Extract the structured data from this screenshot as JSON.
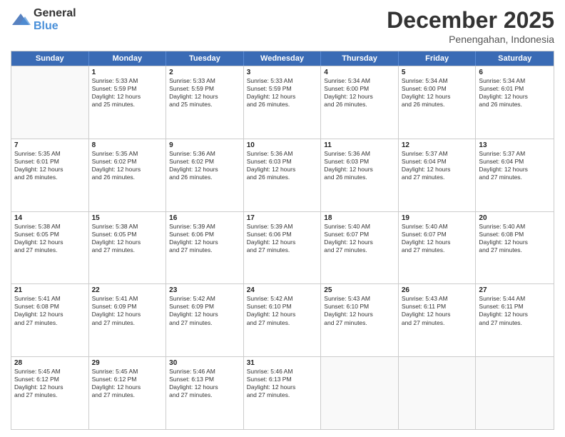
{
  "header": {
    "logo": {
      "general": "General",
      "blue": "Blue"
    },
    "month_year": "December 2025",
    "location": "Penengahan, Indonesia"
  },
  "days_of_week": [
    "Sunday",
    "Monday",
    "Tuesday",
    "Wednesday",
    "Thursday",
    "Friday",
    "Saturday"
  ],
  "rows": [
    [
      {
        "day": "",
        "sunrise": "",
        "sunset": "",
        "daylight": "",
        "empty": true
      },
      {
        "day": "1",
        "sunrise": "Sunrise: 5:33 AM",
        "sunset": "Sunset: 5:59 PM",
        "daylight": "Daylight: 12 hours",
        "daylight2": "and 25 minutes."
      },
      {
        "day": "2",
        "sunrise": "Sunrise: 5:33 AM",
        "sunset": "Sunset: 5:59 PM",
        "daylight": "Daylight: 12 hours",
        "daylight2": "and 25 minutes."
      },
      {
        "day": "3",
        "sunrise": "Sunrise: 5:33 AM",
        "sunset": "Sunset: 5:59 PM",
        "daylight": "Daylight: 12 hours",
        "daylight2": "and 26 minutes."
      },
      {
        "day": "4",
        "sunrise": "Sunrise: 5:34 AM",
        "sunset": "Sunset: 6:00 PM",
        "daylight": "Daylight: 12 hours",
        "daylight2": "and 26 minutes."
      },
      {
        "day": "5",
        "sunrise": "Sunrise: 5:34 AM",
        "sunset": "Sunset: 6:00 PM",
        "daylight": "Daylight: 12 hours",
        "daylight2": "and 26 minutes."
      },
      {
        "day": "6",
        "sunrise": "Sunrise: 5:34 AM",
        "sunset": "Sunset: 6:01 PM",
        "daylight": "Daylight: 12 hours",
        "daylight2": "and 26 minutes."
      }
    ],
    [
      {
        "day": "7",
        "sunrise": "Sunrise: 5:35 AM",
        "sunset": "Sunset: 6:01 PM",
        "daylight": "Daylight: 12 hours",
        "daylight2": "and 26 minutes."
      },
      {
        "day": "8",
        "sunrise": "Sunrise: 5:35 AM",
        "sunset": "Sunset: 6:02 PM",
        "daylight": "Daylight: 12 hours",
        "daylight2": "and 26 minutes."
      },
      {
        "day": "9",
        "sunrise": "Sunrise: 5:36 AM",
        "sunset": "Sunset: 6:02 PM",
        "daylight": "Daylight: 12 hours",
        "daylight2": "and 26 minutes."
      },
      {
        "day": "10",
        "sunrise": "Sunrise: 5:36 AM",
        "sunset": "Sunset: 6:03 PM",
        "daylight": "Daylight: 12 hours",
        "daylight2": "and 26 minutes."
      },
      {
        "day": "11",
        "sunrise": "Sunrise: 5:36 AM",
        "sunset": "Sunset: 6:03 PM",
        "daylight": "Daylight: 12 hours",
        "daylight2": "and 26 minutes."
      },
      {
        "day": "12",
        "sunrise": "Sunrise: 5:37 AM",
        "sunset": "Sunset: 6:04 PM",
        "daylight": "Daylight: 12 hours",
        "daylight2": "and 27 minutes."
      },
      {
        "day": "13",
        "sunrise": "Sunrise: 5:37 AM",
        "sunset": "Sunset: 6:04 PM",
        "daylight": "Daylight: 12 hours",
        "daylight2": "and 27 minutes."
      }
    ],
    [
      {
        "day": "14",
        "sunrise": "Sunrise: 5:38 AM",
        "sunset": "Sunset: 6:05 PM",
        "daylight": "Daylight: 12 hours",
        "daylight2": "and 27 minutes."
      },
      {
        "day": "15",
        "sunrise": "Sunrise: 5:38 AM",
        "sunset": "Sunset: 6:05 PM",
        "daylight": "Daylight: 12 hours",
        "daylight2": "and 27 minutes."
      },
      {
        "day": "16",
        "sunrise": "Sunrise: 5:39 AM",
        "sunset": "Sunset: 6:06 PM",
        "daylight": "Daylight: 12 hours",
        "daylight2": "and 27 minutes."
      },
      {
        "day": "17",
        "sunrise": "Sunrise: 5:39 AM",
        "sunset": "Sunset: 6:06 PM",
        "daylight": "Daylight: 12 hours",
        "daylight2": "and 27 minutes."
      },
      {
        "day": "18",
        "sunrise": "Sunrise: 5:40 AM",
        "sunset": "Sunset: 6:07 PM",
        "daylight": "Daylight: 12 hours",
        "daylight2": "and 27 minutes."
      },
      {
        "day": "19",
        "sunrise": "Sunrise: 5:40 AM",
        "sunset": "Sunset: 6:07 PM",
        "daylight": "Daylight: 12 hours",
        "daylight2": "and 27 minutes."
      },
      {
        "day": "20",
        "sunrise": "Sunrise: 5:40 AM",
        "sunset": "Sunset: 6:08 PM",
        "daylight": "Daylight: 12 hours",
        "daylight2": "and 27 minutes."
      }
    ],
    [
      {
        "day": "21",
        "sunrise": "Sunrise: 5:41 AM",
        "sunset": "Sunset: 6:08 PM",
        "daylight": "Daylight: 12 hours",
        "daylight2": "and 27 minutes."
      },
      {
        "day": "22",
        "sunrise": "Sunrise: 5:41 AM",
        "sunset": "Sunset: 6:09 PM",
        "daylight": "Daylight: 12 hours",
        "daylight2": "and 27 minutes."
      },
      {
        "day": "23",
        "sunrise": "Sunrise: 5:42 AM",
        "sunset": "Sunset: 6:09 PM",
        "daylight": "Daylight: 12 hours",
        "daylight2": "and 27 minutes."
      },
      {
        "day": "24",
        "sunrise": "Sunrise: 5:42 AM",
        "sunset": "Sunset: 6:10 PM",
        "daylight": "Daylight: 12 hours",
        "daylight2": "and 27 minutes."
      },
      {
        "day": "25",
        "sunrise": "Sunrise: 5:43 AM",
        "sunset": "Sunset: 6:10 PM",
        "daylight": "Daylight: 12 hours",
        "daylight2": "and 27 minutes."
      },
      {
        "day": "26",
        "sunrise": "Sunrise: 5:43 AM",
        "sunset": "Sunset: 6:11 PM",
        "daylight": "Daylight: 12 hours",
        "daylight2": "and 27 minutes."
      },
      {
        "day": "27",
        "sunrise": "Sunrise: 5:44 AM",
        "sunset": "Sunset: 6:11 PM",
        "daylight": "Daylight: 12 hours",
        "daylight2": "and 27 minutes."
      }
    ],
    [
      {
        "day": "28",
        "sunrise": "Sunrise: 5:45 AM",
        "sunset": "Sunset: 6:12 PM",
        "daylight": "Daylight: 12 hours",
        "daylight2": "and 27 minutes."
      },
      {
        "day": "29",
        "sunrise": "Sunrise: 5:45 AM",
        "sunset": "Sunset: 6:12 PM",
        "daylight": "Daylight: 12 hours",
        "daylight2": "and 27 minutes."
      },
      {
        "day": "30",
        "sunrise": "Sunrise: 5:46 AM",
        "sunset": "Sunset: 6:13 PM",
        "daylight": "Daylight: 12 hours",
        "daylight2": "and 27 minutes."
      },
      {
        "day": "31",
        "sunrise": "Sunrise: 5:46 AM",
        "sunset": "Sunset: 6:13 PM",
        "daylight": "Daylight: 12 hours",
        "daylight2": "and 27 minutes."
      },
      {
        "day": "",
        "sunrise": "",
        "sunset": "",
        "daylight": "",
        "daylight2": "",
        "empty": true
      },
      {
        "day": "",
        "sunrise": "",
        "sunset": "",
        "daylight": "",
        "daylight2": "",
        "empty": true
      },
      {
        "day": "",
        "sunrise": "",
        "sunset": "",
        "daylight": "",
        "daylight2": "",
        "empty": true
      }
    ]
  ]
}
